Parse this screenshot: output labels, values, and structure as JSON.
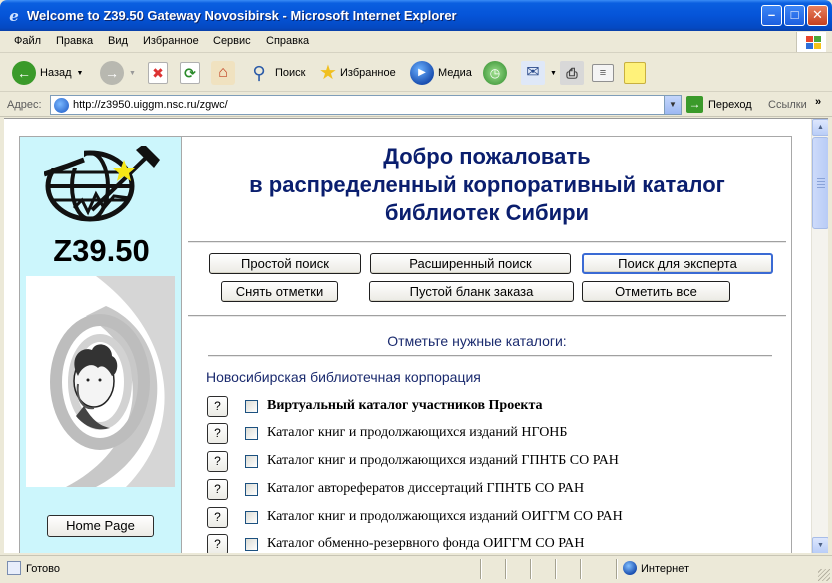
{
  "window": {
    "title": "Welcome to Z39.50 Gateway Novosibirsk - Microsoft Internet Explorer",
    "minimize": "–",
    "maximize": "□",
    "close": "✕"
  },
  "menu": [
    "Файл",
    "Правка",
    "Вид",
    "Избранное",
    "Сервис",
    "Справка"
  ],
  "toolbar": {
    "back_label": "Назад",
    "search_label": "Поиск",
    "favorites_label": "Избранное",
    "media_label": "Медиа"
  },
  "address": {
    "label": "Адрес:",
    "url": "http://z3950.uiggm.nsc.ru/zgwc/",
    "go_label": "Переход",
    "links_label": "Ссылки",
    "chevron": "»"
  },
  "sidebar": {
    "brand": "Z39.50",
    "home_label": "Home Page"
  },
  "page": {
    "welcome_lines": [
      "Добро пожаловать",
      "в распределенный корпоративный каталог",
      "библиотек Сибири"
    ],
    "buttons_row1": [
      "Простой поиск",
      "Расширенный поиск",
      "Поиск для эксперта"
    ],
    "buttons_row2": [
      "Снять отметки",
      "Пустой бланк заказа",
      "Отметить все"
    ],
    "section_title": "Отметьте нужные каталоги:",
    "corporation": "Новосибирская библиотечная корпорация",
    "help_label": "?",
    "catalogs": [
      "Виртуальный каталог участников Проекта",
      "Каталог книг и продолжающихся изданий НГОНБ",
      "Каталог книг и продолжающихся изданий ГПНТБ СО РАН",
      "Каталог авторефератов диссертаций ГПНТБ СО РАН",
      "Каталог книг и продолжающихся изданий ОИГГМ СО РАН",
      "Каталог обменно-резервного фонда ОИГГМ СО РАН"
    ]
  },
  "status": {
    "text": "Готово",
    "zone": "Интернет"
  }
}
